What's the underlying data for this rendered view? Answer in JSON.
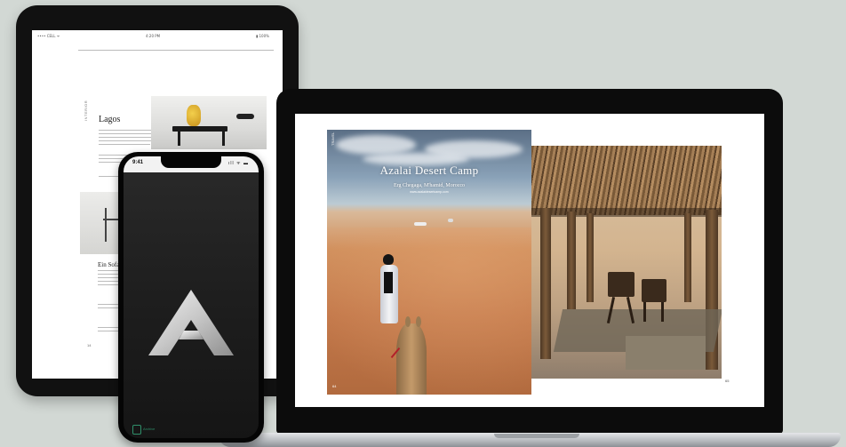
{
  "tablet": {
    "status_left": "•••• CELL ᯤ",
    "status_center": "4:20 PM",
    "status_right": "▮ 100%",
    "side_label": "INTERIOR",
    "heading_1": "Lagos",
    "heading_2": "Ein Sofa",
    "page_number": "14"
  },
  "laptop": {
    "desert_page": {
      "title": "Azalai Desert Camp",
      "subtitle": "Erg Chegaga, M'hamid, Morocco",
      "url": "www.azalaidesertcamp.com",
      "side_label": "TRAVEL",
      "page_number": "64"
    },
    "hut_page": {
      "page_number": "65"
    }
  },
  "phone": {
    "time": "9:41",
    "status_icons": "ıll ᯤ ▬",
    "logo_letter": "A",
    "badge_text": "Archive"
  },
  "colors": {
    "background": "#d2d8d4",
    "device": "#0c0c0c",
    "phone_screen": "#1e1e1e",
    "badge": "#2f8f6a"
  }
}
